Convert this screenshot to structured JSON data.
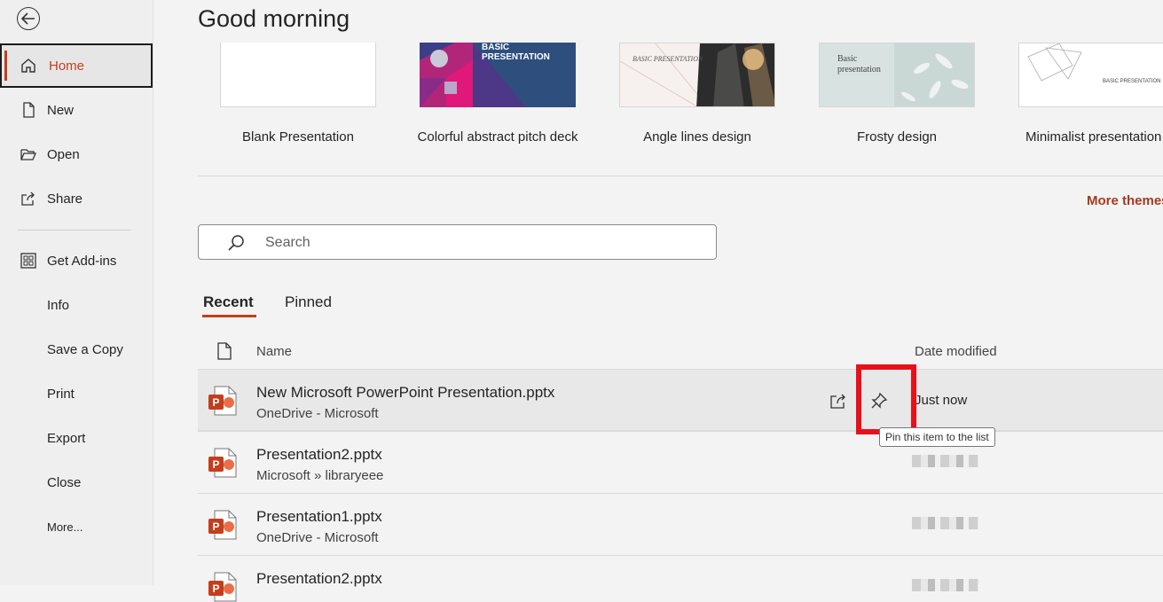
{
  "greeting": "Good morning",
  "sidebar": {
    "items": [
      {
        "label": "Home",
        "icon": "home-icon"
      },
      {
        "label": "New",
        "icon": "new-file-icon"
      },
      {
        "label": "Open",
        "icon": "folder-open-icon"
      },
      {
        "label": "Share",
        "icon": "share-icon"
      },
      {
        "label": "Get Add-ins",
        "icon": "grid-icon"
      },
      {
        "label": "Info"
      },
      {
        "label": "Save a Copy"
      },
      {
        "label": "Print"
      },
      {
        "label": "Export"
      },
      {
        "label": "Close"
      },
      {
        "label": "More..."
      }
    ]
  },
  "templates": [
    {
      "label": "Blank Presentation"
    },
    {
      "label": "Colorful abstract pitch deck",
      "thumb_text": "BASIC PRESENTATION"
    },
    {
      "label": "Angle lines design",
      "thumb_text": "BASIC PRESENTATION"
    },
    {
      "label": "Frosty design",
      "thumb_text": "Basic presentation"
    },
    {
      "label": "Minimalist presentation",
      "thumb_text": "BASIC PRESENTATION"
    }
  ],
  "more_themes": "More themes",
  "search": {
    "placeholder": "Search"
  },
  "tabs": {
    "recent": "Recent",
    "pinned": "Pinned"
  },
  "columns": {
    "name": "Name",
    "date_modified": "Date modified"
  },
  "files": [
    {
      "name": "New Microsoft PowerPoint Presentation.pptx",
      "location": "OneDrive - Microsoft",
      "date": "Just now"
    },
    {
      "name": "Presentation2.pptx",
      "location": "Microsoft » libraryeee",
      "date": ""
    },
    {
      "name": "Presentation1.pptx",
      "location": "OneDrive - Microsoft",
      "date": ""
    },
    {
      "name": "Presentation2.pptx",
      "location": "",
      "date": ""
    }
  ],
  "tooltip": "Pin this item to the list",
  "colors": {
    "accent": "#c43e1c",
    "highlight": "#e8101a",
    "powerpoint": "#c43e1c"
  }
}
